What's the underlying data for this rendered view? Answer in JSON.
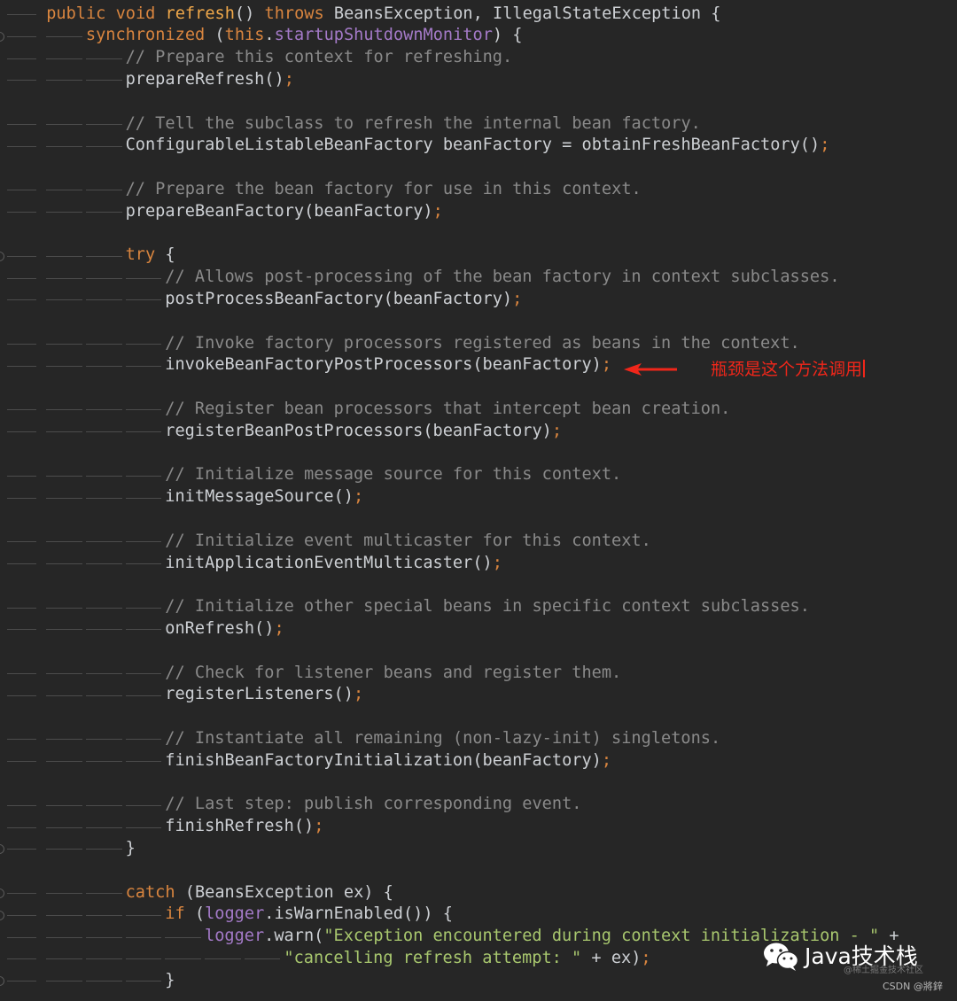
{
  "code": {
    "lines": [
      {
        "indent": 1,
        "fold": false,
        "tokens": [
          [
            "kw",
            "public "
          ],
          [
            "kw",
            "void "
          ],
          [
            "fn",
            "refresh"
          ],
          [
            "pl",
            "() "
          ],
          [
            "kw",
            "throws "
          ],
          [
            "pl",
            "BeansException, IllegalStateException {"
          ]
        ]
      },
      {
        "indent": 2,
        "fold": true,
        "tokens": [
          [
            "kw",
            "synchronized "
          ],
          [
            "pl",
            "("
          ],
          [
            "kw",
            "this"
          ],
          [
            "pl",
            "."
          ],
          [
            "mb",
            "startupShutdownMonitor"
          ],
          [
            "pl",
            ") {"
          ]
        ]
      },
      {
        "indent": 3,
        "fold": false,
        "tokens": [
          [
            "cm",
            "// Prepare this context for refreshing."
          ]
        ]
      },
      {
        "indent": 3,
        "fold": false,
        "tokens": [
          [
            "pl",
            "prepareRefresh()"
          ],
          [
            "sc",
            ";"
          ]
        ]
      },
      {
        "indent": 0,
        "fold": false,
        "tokens": []
      },
      {
        "indent": 3,
        "fold": false,
        "tokens": [
          [
            "cm",
            "// Tell the subclass to refresh the internal bean factory."
          ]
        ]
      },
      {
        "indent": 3,
        "fold": false,
        "tokens": [
          [
            "pl",
            "ConfigurableListableBeanFactory beanFactory = obtainFreshBeanFactory()"
          ],
          [
            "sc",
            ";"
          ]
        ]
      },
      {
        "indent": 0,
        "fold": false,
        "tokens": []
      },
      {
        "indent": 3,
        "fold": false,
        "tokens": [
          [
            "cm",
            "// Prepare the bean factory for use in this context."
          ]
        ]
      },
      {
        "indent": 3,
        "fold": false,
        "tokens": [
          [
            "pl",
            "prepareBeanFactory(beanFactory)"
          ],
          [
            "sc",
            ";"
          ]
        ]
      },
      {
        "indent": 0,
        "fold": false,
        "tokens": []
      },
      {
        "indent": 3,
        "fold": true,
        "tokens": [
          [
            "kw",
            "try "
          ],
          [
            "pl",
            "{"
          ]
        ]
      },
      {
        "indent": 4,
        "fold": false,
        "tokens": [
          [
            "cm",
            "// Allows post-processing of the bean factory in context subclasses."
          ]
        ]
      },
      {
        "indent": 4,
        "fold": false,
        "tokens": [
          [
            "pl",
            "postProcessBeanFactory(beanFactory)"
          ],
          [
            "sc",
            ";"
          ]
        ]
      },
      {
        "indent": 0,
        "fold": false,
        "tokens": []
      },
      {
        "indent": 4,
        "fold": false,
        "tokens": [
          [
            "cm",
            "// Invoke factory processors registered as beans in the context."
          ]
        ]
      },
      {
        "indent": 4,
        "fold": false,
        "tokens": [
          [
            "pl",
            "invokeBeanFactoryPostProcessors(beanFactory)"
          ],
          [
            "sc",
            ";"
          ]
        ]
      },
      {
        "indent": 0,
        "fold": false,
        "tokens": []
      },
      {
        "indent": 4,
        "fold": false,
        "tokens": [
          [
            "cm",
            "// Register bean processors that intercept bean creation."
          ]
        ]
      },
      {
        "indent": 4,
        "fold": false,
        "tokens": [
          [
            "pl",
            "registerBeanPostProcessors(beanFactory)"
          ],
          [
            "sc",
            ";"
          ]
        ]
      },
      {
        "indent": 0,
        "fold": false,
        "tokens": []
      },
      {
        "indent": 4,
        "fold": false,
        "tokens": [
          [
            "cm",
            "// Initialize message source for this context."
          ]
        ]
      },
      {
        "indent": 4,
        "fold": false,
        "tokens": [
          [
            "pl",
            "initMessageSource()"
          ],
          [
            "sc",
            ";"
          ]
        ]
      },
      {
        "indent": 0,
        "fold": false,
        "tokens": []
      },
      {
        "indent": 4,
        "fold": false,
        "tokens": [
          [
            "cm",
            "// Initialize event multicaster for this context."
          ]
        ]
      },
      {
        "indent": 4,
        "fold": false,
        "tokens": [
          [
            "pl",
            "initApplicationEventMulticaster()"
          ],
          [
            "sc",
            ";"
          ]
        ]
      },
      {
        "indent": 0,
        "fold": false,
        "tokens": []
      },
      {
        "indent": 4,
        "fold": false,
        "tokens": [
          [
            "cm",
            "// Initialize other special beans in specific context subclasses."
          ]
        ]
      },
      {
        "indent": 4,
        "fold": false,
        "tokens": [
          [
            "pl",
            "onRefresh()"
          ],
          [
            "sc",
            ";"
          ]
        ]
      },
      {
        "indent": 0,
        "fold": false,
        "tokens": []
      },
      {
        "indent": 4,
        "fold": false,
        "tokens": [
          [
            "cm",
            "// Check for listener beans and register them."
          ]
        ]
      },
      {
        "indent": 4,
        "fold": false,
        "tokens": [
          [
            "pl",
            "registerListeners()"
          ],
          [
            "sc",
            ";"
          ]
        ]
      },
      {
        "indent": 0,
        "fold": false,
        "tokens": []
      },
      {
        "indent": 4,
        "fold": false,
        "tokens": [
          [
            "cm",
            "// Instantiate all remaining (non-lazy-init) singletons."
          ]
        ]
      },
      {
        "indent": 4,
        "fold": false,
        "tokens": [
          [
            "pl",
            "finishBeanFactoryInitialization(beanFactory)"
          ],
          [
            "sc",
            ";"
          ]
        ]
      },
      {
        "indent": 0,
        "fold": false,
        "tokens": []
      },
      {
        "indent": 4,
        "fold": false,
        "tokens": [
          [
            "cm",
            "// Last step: publish corresponding event."
          ]
        ]
      },
      {
        "indent": 4,
        "fold": false,
        "tokens": [
          [
            "pl",
            "finishRefresh()"
          ],
          [
            "sc",
            ";"
          ]
        ]
      },
      {
        "indent": 3,
        "fold": true,
        "tokens": [
          [
            "pl",
            "}"
          ]
        ]
      },
      {
        "indent": 0,
        "fold": false,
        "tokens": []
      },
      {
        "indent": 3,
        "fold": true,
        "tokens": [
          [
            "kw",
            "catch "
          ],
          [
            "pl",
            "(BeansException ex) {"
          ]
        ]
      },
      {
        "indent": 4,
        "fold": true,
        "tokens": [
          [
            "kw",
            "if "
          ],
          [
            "pl",
            "("
          ],
          [
            "mb",
            "logger"
          ],
          [
            "pl",
            ".isWarnEnabled()) {"
          ]
        ]
      },
      {
        "indent": 5,
        "fold": false,
        "tokens": [
          [
            "mb",
            "logger"
          ],
          [
            "pl",
            ".warn("
          ],
          [
            "st",
            "\"Exception encountered during context initialization - \""
          ],
          [
            "pl",
            " +"
          ]
        ]
      },
      {
        "indent": 7,
        "fold": false,
        "tokens": [
          [
            "st",
            "\"cancelling refresh attempt: \""
          ],
          [
            "pl",
            " + ex)"
          ],
          [
            "sc",
            ";"
          ]
        ]
      },
      {
        "indent": 4,
        "fold": true,
        "tokens": [
          [
            "pl",
            "}"
          ]
        ]
      }
    ]
  },
  "annotation": {
    "text": "瓶颈是这个方法调用",
    "color": "#f0261a"
  },
  "watermark": {
    "brand": "Java技术栈",
    "sub": "@稀土掘金技术社区",
    "csdn": "CSDN @將鋅",
    "logo_icon": "wechat-icon"
  }
}
